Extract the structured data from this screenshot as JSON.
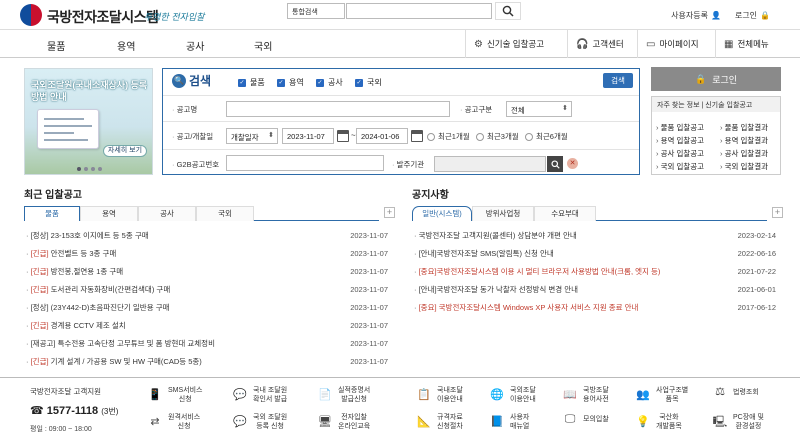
{
  "header": {
    "logo_text": "국방전자조달시스템",
    "logo_sub": "투명한 전자입찰",
    "search_scope": "통합검색",
    "search_placeholder": "",
    "links": [
      {
        "label": "사용자등록",
        "icon": "user-icon"
      },
      {
        "label": "로그인",
        "icon": "lock-icon"
      }
    ]
  },
  "gnb": {
    "menus": [
      "물품",
      "용역",
      "공사",
      "국외"
    ],
    "right": [
      {
        "label": "신기술 입찰공고",
        "icon": "tech-icon"
      },
      {
        "label": "고객센터",
        "icon": "headset-icon"
      },
      {
        "label": "마이페이지",
        "icon": "monitor-icon"
      },
      {
        "label": "전체메뉴",
        "icon": "grid-icon"
      }
    ]
  },
  "banner": {
    "title": "국외조달원(국내소재상사) 등록방법 안내",
    "button": "자세히 보기"
  },
  "search_panel": {
    "title": "검색",
    "checks": [
      "물품",
      "용역",
      "공사",
      "국외"
    ],
    "submit": "검색",
    "fields": {
      "notice_name_label": "공고명",
      "notice_type_label": "공고구분",
      "notice_type_value": "전체",
      "date_label": "공고/개찰일",
      "date_type": "개찰일자",
      "date_from": "2023-11-07",
      "date_to": "2024-01-06",
      "periods": [
        "최근1개월",
        "최근3개월",
        "최근6개월"
      ],
      "g2b_label": "G2B공고번호",
      "org_label": "발주기관"
    }
  },
  "login": {
    "button": "로그인",
    "quick_title": "자주 찾는 정보 | 신기술 입찰공고",
    "left": [
      "물품 입찰공고",
      "용역 입찰공고",
      "공사 입찰공고",
      "국외 입찰공고"
    ],
    "right": [
      "물품 입찰결과",
      "용역 입찰결과",
      "공사 입찰결과",
      "국외 입찰결과"
    ]
  },
  "recent": {
    "title": "최근 입찰공고",
    "tabs": [
      "물품",
      "용역",
      "공사",
      "국외"
    ],
    "rows": [
      {
        "tag": "[정상]",
        "text": "23-153호 이지에트 등 5종 구매",
        "date": "2023-11-07",
        "urgent": false
      },
      {
        "tag": "[긴급]",
        "text": "안전벨트 등 3종 구매",
        "date": "2023-11-07",
        "urgent": true
      },
      {
        "tag": "[긴급]",
        "text": "방전봉,절연용 1종 구매",
        "date": "2023-11-07",
        "urgent": true
      },
      {
        "tag": "[긴급]",
        "text": "도서관리 자동화장비(간편검색대) 구매",
        "date": "2023-11-07",
        "urgent": true
      },
      {
        "tag": "[정상]",
        "text": "(23Y442-D)초음파진단기 일반용 구매",
        "date": "2023-11-07",
        "urgent": false
      },
      {
        "tag": "[긴급]",
        "text": "경계용 CCTV 제조 설치",
        "date": "2023-11-07",
        "urgent": true
      },
      {
        "tag": "[재공고]",
        "text": "특수전용 고속단정 고무튜브 및 폼 방현대 교체정비",
        "date": "2023-11-07",
        "urgent": false
      },
      {
        "tag": "[긴급]",
        "text": "기계 설계 / 가공용 SW 및 HW 구매(CAD등 5종)",
        "date": "2023-11-07",
        "urgent": true
      }
    ]
  },
  "notice": {
    "title": "공지사항",
    "tabs": [
      "일반(시스템)",
      "방위사업청",
      "수요부대"
    ],
    "rows": [
      {
        "text": "국방전자조달 고객지원(콜센터) 상담분야 개편 안내",
        "date": "2023-02-14",
        "red": false
      },
      {
        "text": "[안내]국방전자조달 SMS(알림톡) 신청 안내",
        "date": "2022-06-16",
        "red": false
      },
      {
        "text": "[중요]국방전자조달시스템 이용 시 멀티 브라우저 사용방법 안내(크롬, 엣지 등)",
        "date": "2021-07-22",
        "red": true
      },
      {
        "text": "[안내]국방전자조달 동가 낙찰자 선정방식 변경 안내",
        "date": "2021-06-01",
        "red": false
      },
      {
        "text": "[중요] 국방전자조달시스템 Windows XP 사용자 서비스 지원 종료 안내",
        "date": "2017-06-12",
        "red": true
      }
    ]
  },
  "customer": {
    "title": "국방전자조달 고객지원",
    "phone": "☎ 1577-1118",
    "phone_suffix": "(3번)",
    "hours": "평일 : 09:00 ~ 18:00"
  },
  "shortcuts_left": [
    {
      "label": "SMS서비스\n신청",
      "icon": "sms-icon"
    },
    {
      "label": "국내 조달원\n확인서 발급",
      "icon": "chat-icon"
    },
    {
      "label": "실적증명서\n발급신청",
      "icon": "cert-icon"
    },
    {
      "label": "원격서비스\n신청",
      "icon": "remote-icon"
    },
    {
      "label": "국외 조달원\n등록 신청",
      "icon": "chat-icon"
    },
    {
      "label": "전자입찰\n온라인교육",
      "icon": "edu-icon"
    }
  ],
  "shortcuts_right": [
    {
      "label": "국내조달\n이용안내",
      "icon": "doc-icon"
    },
    {
      "label": "국외조달\n이용안내",
      "icon": "globe-icon"
    },
    {
      "label": "국방조달\n용어사전",
      "icon": "book-icon"
    },
    {
      "label": "사업구조별\n품목",
      "icon": "people-icon"
    },
    {
      "label": "법령조회",
      "icon": "gavel-icon"
    },
    {
      "label": "규격자료\n신청절차",
      "icon": "spec-icon"
    },
    {
      "label": "사용자\n매뉴얼",
      "icon": "manual-icon"
    },
    {
      "label": "모의입찰",
      "icon": "monitor-icon"
    },
    {
      "label": "국산화\n개발품목",
      "icon": "bulb-icon"
    },
    {
      "label": "PC장애 및\n환경설정",
      "icon": "pc-icon"
    }
  ]
}
